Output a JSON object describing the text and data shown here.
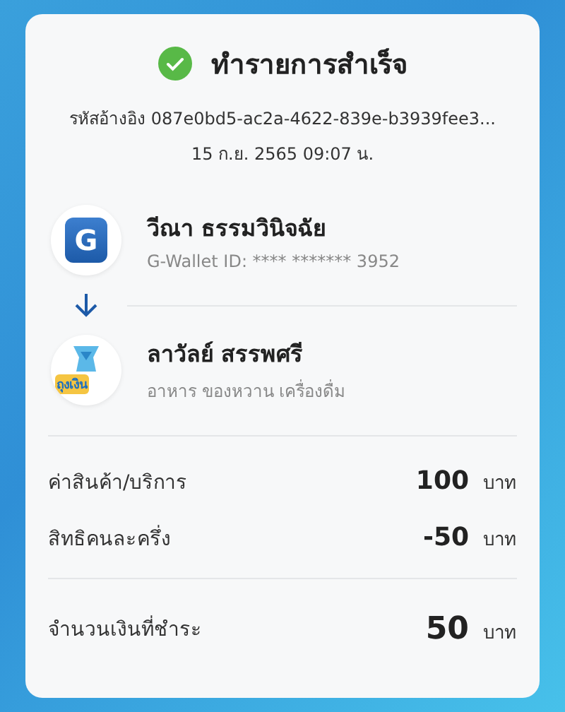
{
  "header": {
    "title": "ทำรายการสำเร็จ",
    "reference": "รหัสอ้างอิง 087e0bd5-ac2a-4622-839e-b3939fee3...",
    "datetime": "15 ก.ย. 2565 09:07 น."
  },
  "parties": [
    {
      "kind": "wallet",
      "logo_text": "G",
      "name": "วีณา ธรรมวินิจฉัย",
      "detail": "G-Wallet ID: **** ******* 3952"
    },
    {
      "kind": "shop",
      "logo_text": "ถุงเงิน",
      "name": "ลาวัลย์ สรรพศรี",
      "detail": "อาหาร ของหวาน เครื่องดื่ม"
    }
  ],
  "lines": [
    {
      "label": "ค่าสินค้า/บริการ",
      "amount": "100",
      "unit": "บาท"
    },
    {
      "label": "สิทธิคนละครึ่ง",
      "amount": "-50",
      "unit": "บาท"
    }
  ],
  "total": {
    "label": "จำนวนเงินที่ชำระ",
    "amount": "50",
    "unit": "บาท"
  }
}
